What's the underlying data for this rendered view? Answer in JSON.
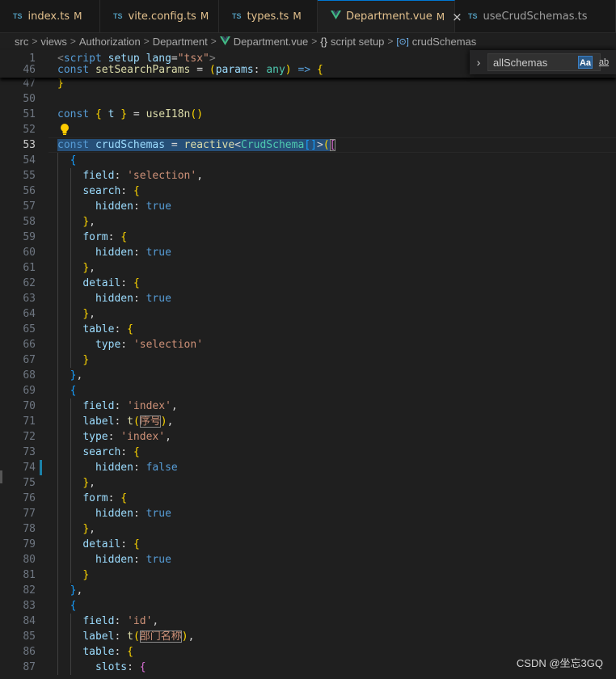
{
  "tabs": [
    {
      "lang": "TS",
      "name": "index.ts",
      "status": "M",
      "active": false
    },
    {
      "lang": "TS",
      "name": "vite.config.ts",
      "status": "M",
      "active": false
    },
    {
      "lang": "TS",
      "name": "types.ts",
      "status": "M",
      "active": false
    },
    {
      "lang": "Vue",
      "name": "Department.vue",
      "status": "M",
      "active": true,
      "close": "×"
    },
    {
      "lang": "TS",
      "name": "useCrudSchemas.ts",
      "status": "",
      "active": false
    }
  ],
  "breadcrumb": {
    "parts": [
      "src",
      "views",
      "Authorization",
      "Department"
    ],
    "file": "Department.vue",
    "section": "script setup",
    "section_icon": "{}",
    "symbol": "crudSchemas"
  },
  "find": {
    "value": "allSchemas",
    "match_case": "Aa",
    "whole_word": "ab"
  },
  "editor": {
    "current_line": "53",
    "sticky_lines": [
      {
        "num": "1",
        "tokens": [
          [
            "tag",
            "<"
          ],
          [
            "tn",
            "script"
          ],
          [
            "p",
            " "
          ],
          [
            "at",
            "setup"
          ],
          [
            "p",
            " "
          ],
          [
            "at",
            "lang"
          ],
          [
            "p",
            "="
          ],
          [
            "s",
            "\"tsx\""
          ],
          [
            "tag",
            ">"
          ]
        ]
      },
      {
        "num": "46",
        "tokens": [
          [
            "k",
            "const"
          ],
          [
            "p",
            " "
          ],
          [
            "f",
            "setSearchParams"
          ],
          [
            "p",
            " = "
          ],
          [
            "b1",
            "("
          ],
          [
            "v",
            "params"
          ],
          [
            "p",
            ": "
          ],
          [
            "ty",
            "any"
          ],
          [
            "b1",
            ")"
          ],
          [
            "p",
            " "
          ],
          [
            "k",
            "=>"
          ],
          [
            "p",
            " "
          ],
          [
            "b1",
            "{"
          ]
        ]
      }
    ],
    "lines": [
      {
        "num": "47",
        "tokens": [
          [
            "b1",
            "}"
          ]
        ]
      },
      {
        "num": "50",
        "tokens": []
      },
      {
        "num": "51",
        "tokens": [
          [
            "k",
            "const"
          ],
          [
            "p",
            " "
          ],
          [
            "b1",
            "{"
          ],
          [
            "p",
            " "
          ],
          [
            "v",
            "t"
          ],
          [
            "p",
            " "
          ],
          [
            "b1",
            "}"
          ],
          [
            "p",
            " = "
          ],
          [
            "f",
            "useI18n"
          ],
          [
            "b1",
            "()"
          ]
        ]
      },
      {
        "num": "52",
        "tokens": []
      },
      {
        "num": "53",
        "tokens": [
          [
            "k sel",
            "const"
          ],
          [
            "p sel",
            " "
          ],
          [
            "v sel",
            "crudSchemas"
          ],
          [
            "p sel",
            " = "
          ],
          [
            "f sel",
            "reactive"
          ],
          [
            "p sel",
            "<"
          ],
          [
            "ty sel",
            "CrudSchema"
          ],
          [
            "b3 sel",
            "[]"
          ],
          [
            "p sel",
            ">"
          ],
          [
            "b1 sel",
            "("
          ],
          [
            "b2 box",
            "["
          ]
        ]
      },
      {
        "num": "54",
        "tokens": [
          [
            "p",
            "  "
          ],
          [
            "b3",
            "{"
          ]
        ]
      },
      {
        "num": "55",
        "tokens": [
          [
            "p",
            "    "
          ],
          [
            "v",
            "field"
          ],
          [
            "p",
            ": "
          ],
          [
            "s",
            "'selection'"
          ],
          [
            "p",
            ","
          ]
        ]
      },
      {
        "num": "56",
        "tokens": [
          [
            "p",
            "    "
          ],
          [
            "v",
            "search"
          ],
          [
            "p",
            ": "
          ],
          [
            "b1",
            "{"
          ]
        ]
      },
      {
        "num": "57",
        "tokens": [
          [
            "p",
            "      "
          ],
          [
            "v",
            "hidden"
          ],
          [
            "p",
            ": "
          ],
          [
            "k",
            "true"
          ]
        ]
      },
      {
        "num": "58",
        "tokens": [
          [
            "p",
            "    "
          ],
          [
            "b1",
            "}"
          ],
          [
            "p",
            ","
          ]
        ]
      },
      {
        "num": "59",
        "tokens": [
          [
            "p",
            "    "
          ],
          [
            "v",
            "form"
          ],
          [
            "p",
            ": "
          ],
          [
            "b1",
            "{"
          ]
        ]
      },
      {
        "num": "60",
        "tokens": [
          [
            "p",
            "      "
          ],
          [
            "v",
            "hidden"
          ],
          [
            "p",
            ": "
          ],
          [
            "k",
            "true"
          ]
        ]
      },
      {
        "num": "61",
        "tokens": [
          [
            "p",
            "    "
          ],
          [
            "b1",
            "}"
          ],
          [
            "p",
            ","
          ]
        ]
      },
      {
        "num": "62",
        "tokens": [
          [
            "p",
            "    "
          ],
          [
            "v",
            "detail"
          ],
          [
            "p",
            ": "
          ],
          [
            "b1",
            "{"
          ]
        ]
      },
      {
        "num": "63",
        "tokens": [
          [
            "p",
            "      "
          ],
          [
            "v",
            "hidden"
          ],
          [
            "p",
            ": "
          ],
          [
            "k",
            "true"
          ]
        ]
      },
      {
        "num": "64",
        "tokens": [
          [
            "p",
            "    "
          ],
          [
            "b1",
            "}"
          ],
          [
            "p",
            ","
          ]
        ]
      },
      {
        "num": "65",
        "tokens": [
          [
            "p",
            "    "
          ],
          [
            "v",
            "table"
          ],
          [
            "p",
            ": "
          ],
          [
            "b1",
            "{"
          ]
        ]
      },
      {
        "num": "66",
        "tokens": [
          [
            "p",
            "      "
          ],
          [
            "v",
            "type"
          ],
          [
            "p",
            ": "
          ],
          [
            "s",
            "'selection'"
          ]
        ]
      },
      {
        "num": "67",
        "tokens": [
          [
            "p",
            "    "
          ],
          [
            "b1",
            "}"
          ]
        ]
      },
      {
        "num": "68",
        "tokens": [
          [
            "p",
            "  "
          ],
          [
            "b3",
            "}"
          ],
          [
            "p",
            ","
          ]
        ]
      },
      {
        "num": "69",
        "tokens": [
          [
            "p",
            "  "
          ],
          [
            "b3",
            "{"
          ]
        ]
      },
      {
        "num": "70",
        "tokens": [
          [
            "p",
            "    "
          ],
          [
            "v",
            "field"
          ],
          [
            "p",
            ": "
          ],
          [
            "s",
            "'index'"
          ],
          [
            "p",
            ","
          ]
        ]
      },
      {
        "num": "71",
        "tokens": [
          [
            "p",
            "    "
          ],
          [
            "v",
            "label"
          ],
          [
            "p",
            ": "
          ],
          [
            "f",
            "t"
          ],
          [
            "b1",
            "("
          ],
          [
            "s box",
            "序号"
          ],
          [
            "b1",
            ")"
          ],
          [
            "p",
            ","
          ]
        ]
      },
      {
        "num": "72",
        "tokens": [
          [
            "p",
            "    "
          ],
          [
            "v",
            "type"
          ],
          [
            "p",
            ": "
          ],
          [
            "s",
            "'index'"
          ],
          [
            "p",
            ","
          ]
        ]
      },
      {
        "num": "73",
        "tokens": [
          [
            "p",
            "    "
          ],
          [
            "v",
            "search"
          ],
          [
            "p",
            ": "
          ],
          [
            "b1",
            "{"
          ]
        ]
      },
      {
        "num": "74",
        "tokens": [
          [
            "p",
            "      "
          ],
          [
            "v",
            "hidden"
          ],
          [
            "p",
            ": "
          ],
          [
            "k",
            "false"
          ]
        ]
      },
      {
        "num": "75",
        "tokens": [
          [
            "p",
            "    "
          ],
          [
            "b1",
            "}"
          ],
          [
            "p",
            ","
          ]
        ]
      },
      {
        "num": "76",
        "tokens": [
          [
            "p",
            "    "
          ],
          [
            "v",
            "form"
          ],
          [
            "p",
            ": "
          ],
          [
            "b1",
            "{"
          ]
        ]
      },
      {
        "num": "77",
        "tokens": [
          [
            "p",
            "      "
          ],
          [
            "v",
            "hidden"
          ],
          [
            "p",
            ": "
          ],
          [
            "k",
            "true"
          ]
        ]
      },
      {
        "num": "78",
        "tokens": [
          [
            "p",
            "    "
          ],
          [
            "b1",
            "}"
          ],
          [
            "p",
            ","
          ]
        ]
      },
      {
        "num": "79",
        "tokens": [
          [
            "p",
            "    "
          ],
          [
            "v",
            "detail"
          ],
          [
            "p",
            ": "
          ],
          [
            "b1",
            "{"
          ]
        ]
      },
      {
        "num": "80",
        "tokens": [
          [
            "p",
            "      "
          ],
          [
            "v",
            "hidden"
          ],
          [
            "p",
            ": "
          ],
          [
            "k",
            "true"
          ]
        ]
      },
      {
        "num": "81",
        "tokens": [
          [
            "p",
            "    "
          ],
          [
            "b1",
            "}"
          ]
        ]
      },
      {
        "num": "82",
        "tokens": [
          [
            "p",
            "  "
          ],
          [
            "b3",
            "}"
          ],
          [
            "p",
            ","
          ]
        ]
      },
      {
        "num": "83",
        "tokens": [
          [
            "p",
            "  "
          ],
          [
            "b3",
            "{"
          ]
        ]
      },
      {
        "num": "84",
        "tokens": [
          [
            "p",
            "    "
          ],
          [
            "v",
            "field"
          ],
          [
            "p",
            ": "
          ],
          [
            "s",
            "'id'"
          ],
          [
            "p",
            ","
          ]
        ]
      },
      {
        "num": "85",
        "tokens": [
          [
            "p",
            "    "
          ],
          [
            "v",
            "label"
          ],
          [
            "p",
            ": "
          ],
          [
            "f",
            "t"
          ],
          [
            "b1",
            "("
          ],
          [
            "s box",
            "部门名称"
          ],
          [
            "b1",
            ")"
          ],
          [
            "p",
            ","
          ]
        ]
      },
      {
        "num": "86",
        "tokens": [
          [
            "p",
            "    "
          ],
          [
            "v",
            "table"
          ],
          [
            "p",
            ": "
          ],
          [
            "b1",
            "{"
          ]
        ]
      },
      {
        "num": "87",
        "tokens": [
          [
            "p",
            "      "
          ],
          [
            "v",
            "slots"
          ],
          [
            "p",
            ": "
          ],
          [
            "b2",
            "{"
          ]
        ]
      }
    ]
  },
  "watermark": "CSDN @坐忘3GQ"
}
